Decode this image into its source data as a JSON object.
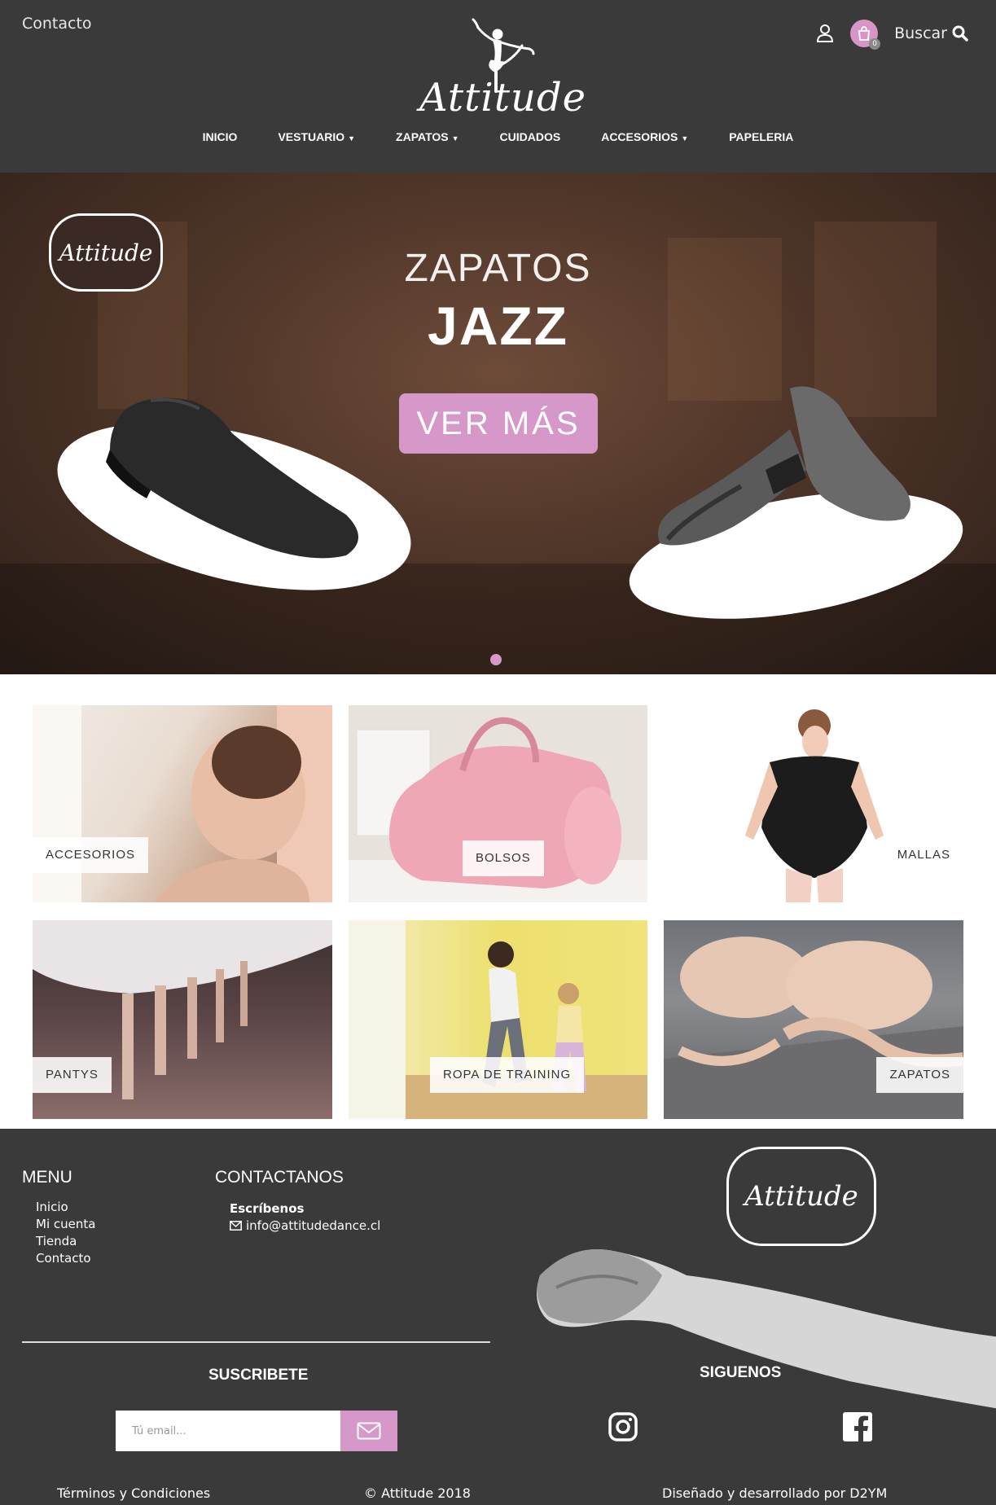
{
  "header": {
    "contacto": "Contacto",
    "logo_text": "Attitude",
    "buscar": "Buscar",
    "cart_count": "0",
    "icons": [
      "user-icon",
      "cart-icon",
      "search-icon"
    ]
  },
  "nav": {
    "items": [
      {
        "label": "INICIO",
        "dropdown": false
      },
      {
        "label": "VESTUARIO",
        "dropdown": true
      },
      {
        "label": "ZAPATOS",
        "dropdown": true
      },
      {
        "label": "CUIDADOS",
        "dropdown": false
      },
      {
        "label": "ACCESORIOS",
        "dropdown": true
      },
      {
        "label": "PAPELERIA",
        "dropdown": false
      }
    ]
  },
  "hero": {
    "badge_text": "Attitude",
    "title_line1": "ZAPATOS",
    "title_line2": "JAZZ",
    "button": "VER MÁS"
  },
  "categories": [
    {
      "label": "ACCESORIOS"
    },
    {
      "label": "BOLSOS"
    },
    {
      "label": "MALLAS"
    },
    {
      "label": "PANTYS"
    },
    {
      "label": "ROPA DE TRAINING"
    },
    {
      "label": "ZAPATOS"
    }
  ],
  "footer": {
    "menu_heading": "MENU",
    "menu_links": [
      "Inicio",
      "Mi cuenta",
      "Tienda",
      "Contacto"
    ],
    "contact_heading": "CONTACTANOS",
    "contact_sub": "Escríbenos",
    "contact_email": "info@attitudedance.cl",
    "logo_text": "Attitude",
    "subscribe_heading": "SUSCRIBETE",
    "email_placeholder": "Tú email...",
    "follow_heading": "SIGUENOS",
    "terms": "Términos y Condiciones",
    "copyright": "© Attitude 2018",
    "credits": "Diseñado y desarrollado por D2YM"
  },
  "colors": {
    "background": "#3a3a3a",
    "accent": "#d598c9",
    "white": "#ffffff"
  }
}
